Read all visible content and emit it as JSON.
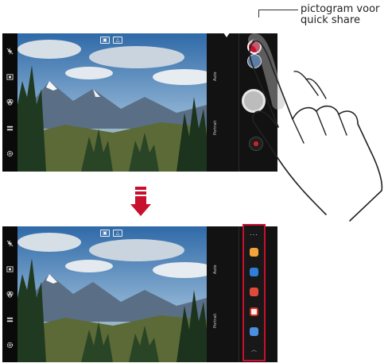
{
  "callout": {
    "line1": "pictogram voor",
    "line2": "quick share"
  },
  "camera": {
    "side_labels": [
      "Auto",
      "Portrait"
    ],
    "top_icons": [
      "flash-icon",
      "timer-icon"
    ],
    "left_icons": [
      "flash-off-icon",
      "mode-icon",
      "filter-icon",
      "settings-icon"
    ]
  },
  "quick_share_panel": {
    "more_label": "...",
    "apps": [
      {
        "name": "notes-app",
        "color": "#f2a33a"
      },
      {
        "name": "contacts-app",
        "color": "#2f7fd8"
      },
      {
        "name": "photo-editor-app",
        "color": "#e04a3a"
      },
      {
        "name": "gmail-app",
        "color": "#f0f0f0"
      },
      {
        "name": "messages-app",
        "color": "#4a90e2"
      }
    ]
  },
  "colors": {
    "accent": "#c8102e"
  }
}
